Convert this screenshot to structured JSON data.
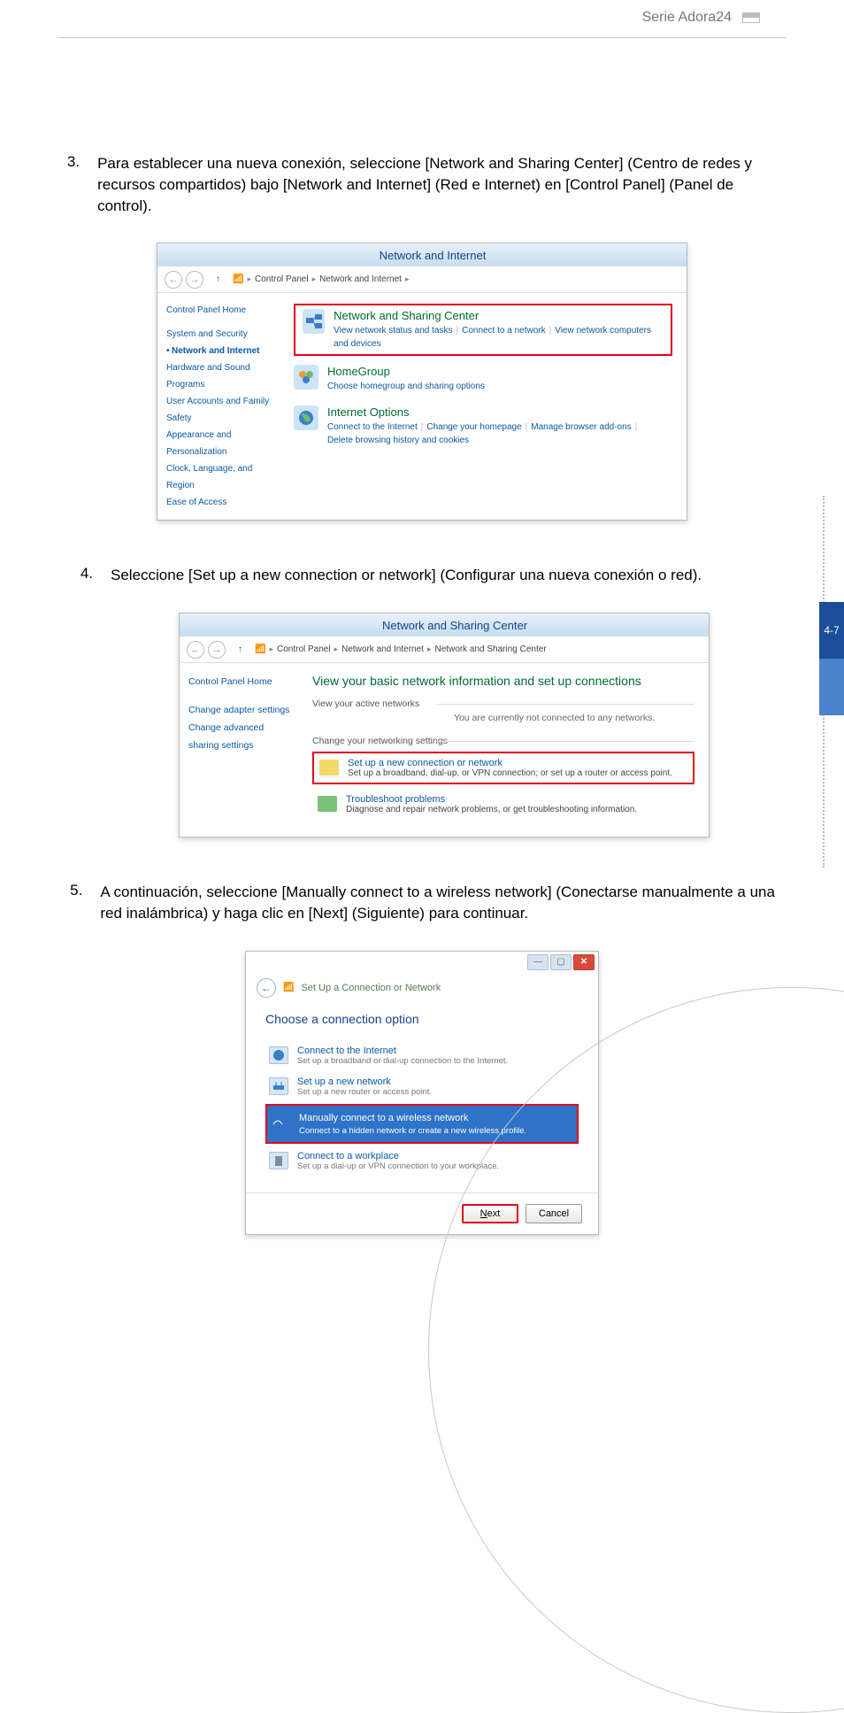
{
  "header": {
    "title": "Serie Adora24"
  },
  "page_tab": "4-7",
  "steps": {
    "s3": {
      "num": "3.",
      "text": "Para establecer una nueva conexión, seleccione [Network and Sharing Center] (Centro de redes y recursos compartidos) bajo [Network and Internet] (Red e Internet) en [Control Panel] (Panel de control)."
    },
    "s4": {
      "num": "4.",
      "text": "Seleccione [Set up a new connection or network] (Configurar una nueva conexión o red)."
    },
    "s5": {
      "num": "5.",
      "text": "A continuación, seleccione [Manually connect to a wireless network] (Conectarse manualmente a una red inalámbrica) y haga clic en [Next] (Siguiente) para continuar."
    }
  },
  "shot1": {
    "title": "Network and Internet",
    "bc1": "Control Panel",
    "bc2": "Network and Internet",
    "side": {
      "home": "Control Panel Home",
      "sys": "System and Security",
      "net": "Network and Internet",
      "hw": "Hardware and Sound",
      "prog": "Programs",
      "users": "User Accounts and Family Safety",
      "app": "Appearance and Personalization",
      "clock": "Clock, Language, and Region",
      "ease": "Ease of Access"
    },
    "items": {
      "nsc": {
        "title": "Network and Sharing Center",
        "l1": "View network status and tasks",
        "l2": "Connect to a network",
        "l3": "View network computers and devices"
      },
      "hg": {
        "title": "HomeGroup",
        "l1": "Choose homegroup and sharing options"
      },
      "io": {
        "title": "Internet Options",
        "l1": "Connect to the Internet",
        "l2": "Change your homepage",
        "l3": "Manage browser add-ons",
        "l4": "Delete browsing history and cookies"
      }
    }
  },
  "shot2": {
    "title": "Network and Sharing Center",
    "bc1": "Control Panel",
    "bc2": "Network and Internet",
    "bc3": "Network and Sharing Center",
    "side": {
      "home": "Control Panel Home",
      "adapter": "Change adapter settings",
      "adv": "Change advanced sharing settings"
    },
    "main": {
      "h1": "View your basic network information and set up connections",
      "sec1": "View your active networks",
      "none": "You are currently not connected to any networks.",
      "sec2": "Change your networking settings",
      "opt1t": "Set up a new connection or network",
      "opt1s": "Set up a broadband, dial-up, or VPN connection; or set up a router or access point.",
      "opt2t": "Troubleshoot problems",
      "opt2s": "Diagnose and repair network problems, or get troubleshooting information."
    }
  },
  "shot3": {
    "header": "Set Up a Connection or Network",
    "title": "Choose a connection option",
    "opts": {
      "o1t": "Connect to the Internet",
      "o1s": "Set up a broadband or dial-up connection to the Internet.",
      "o2t": "Set up a new network",
      "o2s": "Set up a new router or access point.",
      "o3t": "Manually connect to a wireless network",
      "o3s": "Connect to a hidden network or create a new wireless profile.",
      "o4t": "Connect to a workplace",
      "o4s": "Set up a dial-up or VPN connection to your workplace."
    },
    "btn_next": "Next",
    "btn_cancel": "Cancel"
  }
}
